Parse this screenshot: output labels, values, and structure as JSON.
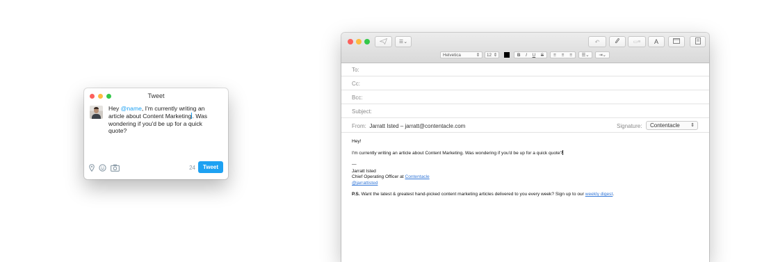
{
  "tweet_window": {
    "title": "Tweet",
    "text_before": "Hey ",
    "mention": "@name",
    "text_after": ", I'm currently writing an article about Content Marketing",
    "text_end": ". Was wondering if you'd be up for a quick quote?",
    "char_count": "24",
    "tweet_button": "Tweet",
    "icons": [
      "location-pin-icon",
      "emoji-icon",
      "camera-icon"
    ]
  },
  "mail_window": {
    "toolbar": {
      "font_family": "Helvetica",
      "font_size": "12",
      "bold": "B",
      "italic": "I",
      "underline": "U",
      "strike": "S",
      "font_button": "A"
    },
    "headers": {
      "to_label": "To:",
      "cc_label": "Cc:",
      "bcc_label": "Bcc:",
      "subject_label": "Subject:",
      "from_label": "From:",
      "from_value": "Jarratt Isted – jarratt@contentacle.com",
      "signature_label": "Signature:",
      "signature_value": "Contentacle"
    },
    "body": {
      "greeting": "Hey!",
      "line1": "I'm currently writing an article about Content Marketing. Was wondering if you'd be up for a quick quote?",
      "dash": "—",
      "name": "Jarratt Isted",
      "role_prefix": "Chief Operating Officer at ",
      "company_link": "Contentacle",
      "handle_link": "@jarrattisted",
      "ps_label": "P.S.",
      "ps_text": " Want the latest & greatest hand-picked content marketing articles delivered to you every week? Sign up to our ",
      "ps_link": "weekly digest",
      "ps_end": "."
    }
  },
  "colors": {
    "twitter_blue": "#1da1f2",
    "link_blue": "#3478d8",
    "close": "#fc605c",
    "minimize": "#fdbc40",
    "zoom": "#34c84a"
  }
}
